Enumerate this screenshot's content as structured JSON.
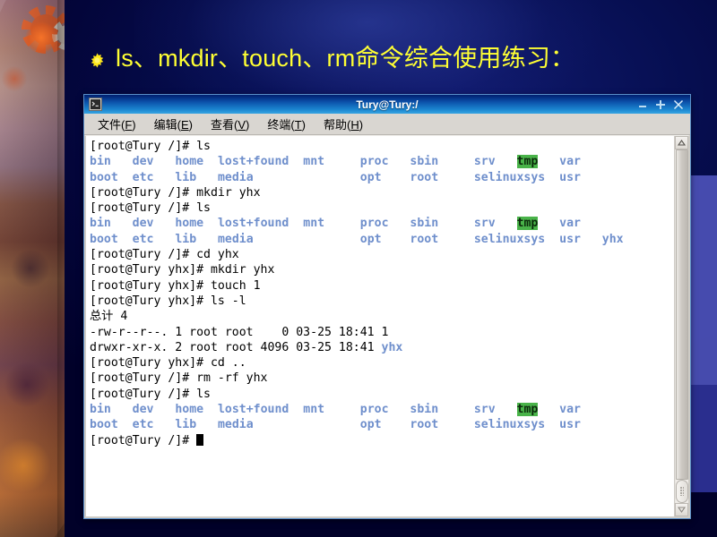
{
  "slide": {
    "title": "ls、mkdir、touch、rm命令综合使用练习：",
    "bullet_icon": "star-bullet-icon",
    "title_color": "#FFFF33",
    "background_color": "#060E50"
  },
  "terminal": {
    "window_icon": "terminal-icon",
    "title": "Tury@Tury:/",
    "window_buttons": [
      {
        "name": "minimize-button",
        "glyph": "–"
      },
      {
        "name": "maximize-button",
        "glyph": "+"
      },
      {
        "name": "close-button",
        "glyph": "✕"
      }
    ],
    "menu": [
      {
        "label_pre": "文件(",
        "accel": "F",
        "label_post": ")"
      },
      {
        "label_pre": "编辑(",
        "accel": "E",
        "label_post": ")"
      },
      {
        "label_pre": "查看(",
        "accel": "V",
        "label_post": ")"
      },
      {
        "label_pre": "终端(",
        "accel": "T",
        "label_post": ")"
      },
      {
        "label_pre": "帮助(",
        "accel": "H",
        "label_post": ")"
      }
    ],
    "colors": {
      "directory": "#6f8fcc",
      "sticky_dir_bg": "#49b349",
      "sticky_dir_fg": "#0b2a0b",
      "text": "#000000",
      "screen_bg": "#ffffff",
      "titlebar_from": "#001e6e",
      "titlebar_to": "#36a4e2"
    },
    "scrollbar": {
      "up_arrow": "^",
      "down_arrow": "v"
    },
    "lines": [
      {
        "type": "prompt",
        "text": "[root@Tury /]# ls"
      },
      {
        "type": "ls",
        "cells": [
          {
            "t": "bin",
            "c": "dir"
          },
          {
            "t": "dev",
            "c": "dir"
          },
          {
            "t": "home",
            "c": "dir"
          },
          {
            "t": "lost+found",
            "c": "dir"
          },
          {
            "t": "mnt",
            "c": "dir"
          },
          {
            "t": "proc",
            "c": "dir"
          },
          {
            "t": "sbin",
            "c": "dir"
          },
          {
            "t": "srv",
            "c": "dir"
          },
          {
            "t": "tmp",
            "c": "sticky"
          },
          {
            "t": "var",
            "c": "dir"
          }
        ]
      },
      {
        "type": "ls",
        "cells": [
          {
            "t": "boot",
            "c": "dir"
          },
          {
            "t": "etc",
            "c": "dir"
          },
          {
            "t": "lib",
            "c": "dir"
          },
          {
            "t": "media",
            "c": "dir"
          },
          {
            "t": "",
            "c": "dir"
          },
          {
            "t": "opt",
            "c": "dir"
          },
          {
            "t": "root",
            "c": "dir"
          },
          {
            "t": "selinux",
            "c": "dir"
          },
          {
            "t": "sys",
            "c": "dir"
          },
          {
            "t": "usr",
            "c": "dir"
          }
        ]
      },
      {
        "type": "prompt",
        "text": "[root@Tury /]# mkdir yhx"
      },
      {
        "type": "prompt",
        "text": "[root@Tury /]# ls"
      },
      {
        "type": "ls",
        "cells": [
          {
            "t": "bin",
            "c": "dir"
          },
          {
            "t": "dev",
            "c": "dir"
          },
          {
            "t": "home",
            "c": "dir"
          },
          {
            "t": "lost+found",
            "c": "dir"
          },
          {
            "t": "mnt",
            "c": "dir"
          },
          {
            "t": "proc",
            "c": "dir"
          },
          {
            "t": "sbin",
            "c": "dir"
          },
          {
            "t": "srv",
            "c": "dir"
          },
          {
            "t": "tmp",
            "c": "sticky"
          },
          {
            "t": "var",
            "c": "dir"
          }
        ]
      },
      {
        "type": "ls",
        "cells": [
          {
            "t": "boot",
            "c": "dir"
          },
          {
            "t": "etc",
            "c": "dir"
          },
          {
            "t": "lib",
            "c": "dir"
          },
          {
            "t": "media",
            "c": "dir"
          },
          {
            "t": "",
            "c": "dir"
          },
          {
            "t": "opt",
            "c": "dir"
          },
          {
            "t": "root",
            "c": "dir"
          },
          {
            "t": "selinux",
            "c": "dir"
          },
          {
            "t": "sys",
            "c": "dir"
          },
          {
            "t": "usr",
            "c": "dir"
          },
          {
            "t": "yhx",
            "c": "dir"
          }
        ]
      },
      {
        "type": "prompt",
        "text": "[root@Tury /]# cd yhx"
      },
      {
        "type": "prompt",
        "text": "[root@Tury yhx]# mkdir yhx"
      },
      {
        "type": "prompt",
        "text": "[root@Tury yhx]# touch 1"
      },
      {
        "type": "prompt",
        "text": "[root@Tury yhx]# ls -l"
      },
      {
        "type": "plain",
        "text": "总计 4"
      },
      {
        "type": "plain",
        "text": "-rw-r--r--. 1 root root    0 03-25 18:41 1"
      },
      {
        "type": "longdir",
        "pre": "drwxr-xr-x. 2 root root 4096 03-25 18:41 ",
        "name": "yhx"
      },
      {
        "type": "prompt",
        "text": "[root@Tury yhx]# cd .."
      },
      {
        "type": "prompt",
        "text": "[root@Tury /]# rm -rf yhx"
      },
      {
        "type": "prompt",
        "text": "[root@Tury /]# ls"
      },
      {
        "type": "ls",
        "cells": [
          {
            "t": "bin",
            "c": "dir"
          },
          {
            "t": "dev",
            "c": "dir"
          },
          {
            "t": "home",
            "c": "dir"
          },
          {
            "t": "lost+found",
            "c": "dir"
          },
          {
            "t": "mnt",
            "c": "dir"
          },
          {
            "t": "proc",
            "c": "dir"
          },
          {
            "t": "sbin",
            "c": "dir"
          },
          {
            "t": "srv",
            "c": "dir"
          },
          {
            "t": "tmp",
            "c": "sticky"
          },
          {
            "t": "var",
            "c": "dir"
          }
        ]
      },
      {
        "type": "ls",
        "cells": [
          {
            "t": "boot",
            "c": "dir"
          },
          {
            "t": "etc",
            "c": "dir"
          },
          {
            "t": "lib",
            "c": "dir"
          },
          {
            "t": "media",
            "c": "dir"
          },
          {
            "t": "",
            "c": "dir"
          },
          {
            "t": "opt",
            "c": "dir"
          },
          {
            "t": "root",
            "c": "dir"
          },
          {
            "t": "selinux",
            "c": "dir"
          },
          {
            "t": "sys",
            "c": "dir"
          },
          {
            "t": "usr",
            "c": "dir"
          }
        ]
      },
      {
        "type": "cursor",
        "text": "[root@Tury /]# "
      }
    ]
  }
}
